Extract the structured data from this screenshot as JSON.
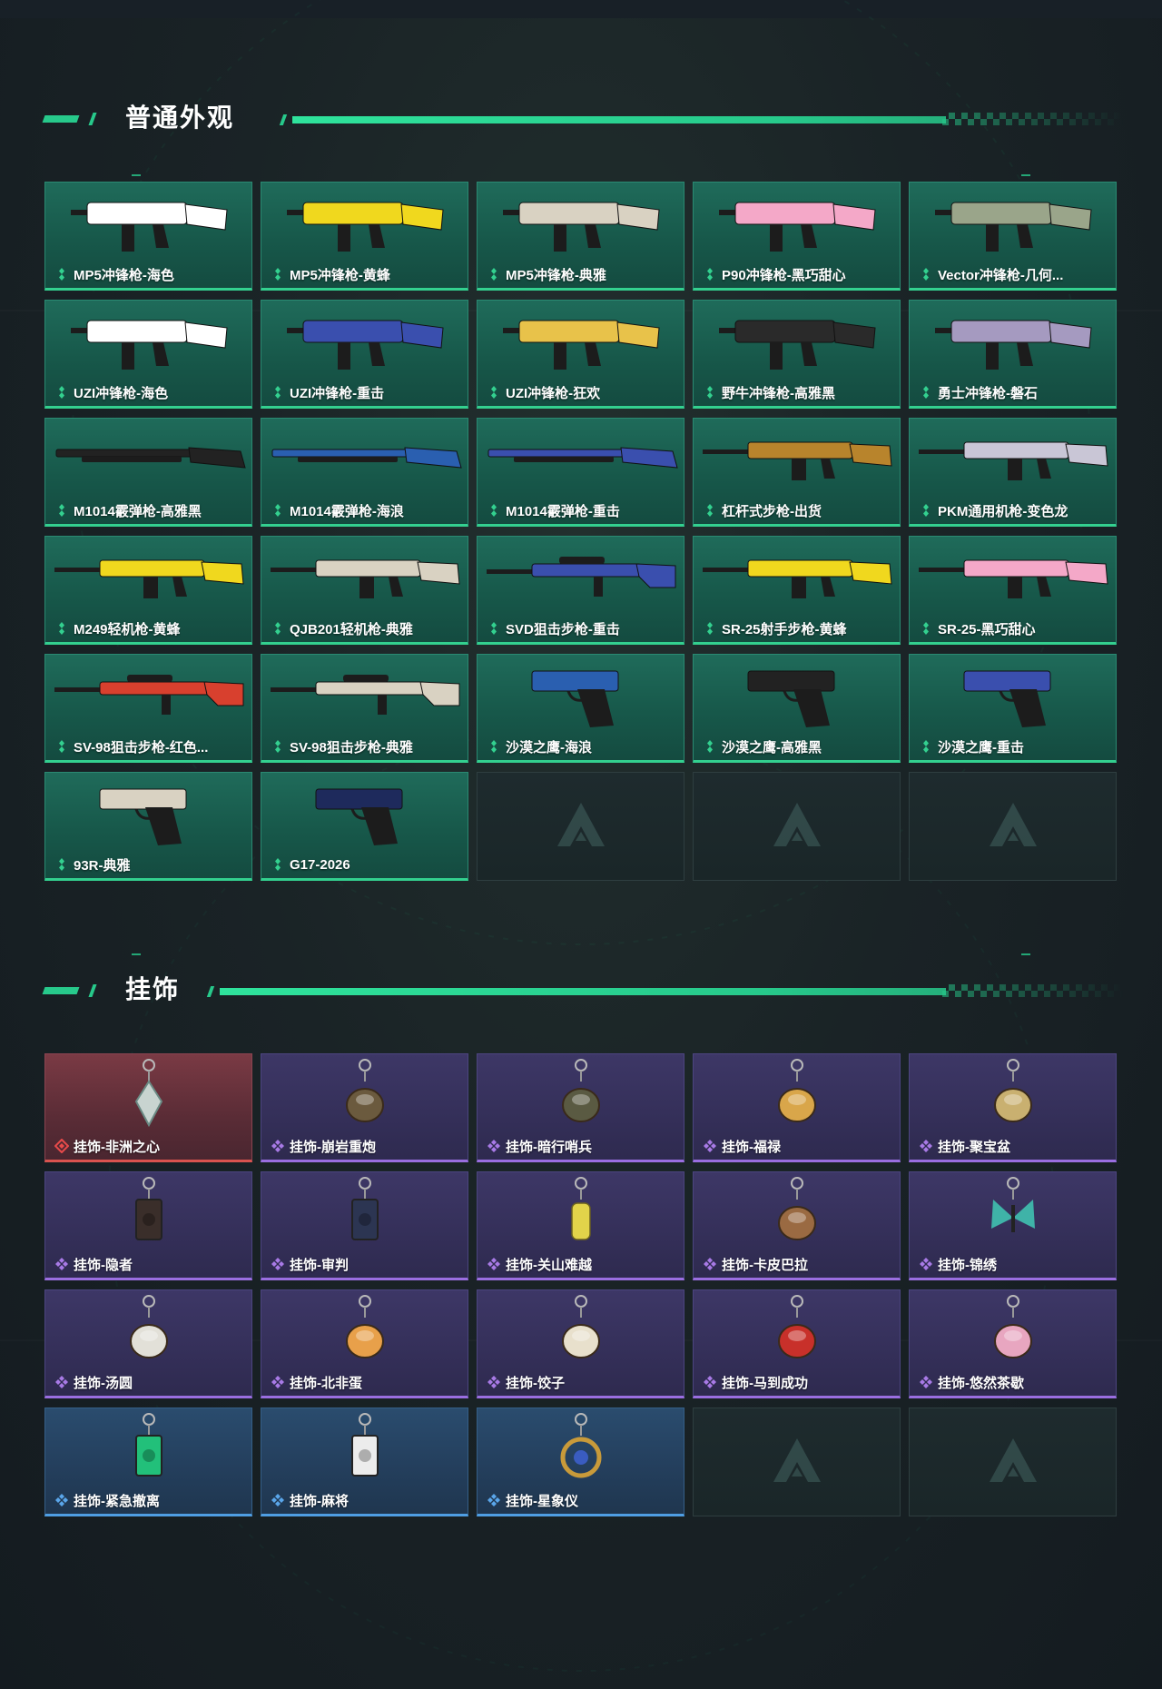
{
  "colors": {
    "accent_green": "#27c98b",
    "weapon_card": "#1b5f50",
    "deco_red": "#d9534f",
    "deco_purple": "#9a6ee0",
    "deco_blue": "#4f9ee3"
  },
  "sections": {
    "weapon_skins": {
      "title": "普通外观",
      "items": [
        {
          "name": "MP5冲锋枪-海色",
          "icon": "smg-icon",
          "color": "#ffffff"
        },
        {
          "name": "MP5冲锋枪-黄蜂",
          "icon": "smg-icon",
          "color": "#f0d81e"
        },
        {
          "name": "MP5冲锋枪-典雅",
          "icon": "smg-icon",
          "color": "#d9d2c2"
        },
        {
          "name": "P90冲锋枪-黑巧甜心",
          "icon": "smg-icon",
          "color": "#f4a8c8"
        },
        {
          "name": "Vector冲锋枪-几何...",
          "icon": "smg-icon",
          "color": "#9aa58a"
        },
        {
          "name": "UZI冲锋枪-海色",
          "icon": "smg-icon",
          "color": "#ffffff"
        },
        {
          "name": "UZI冲锋枪-重击",
          "icon": "smg-icon",
          "color": "#3a4fae"
        },
        {
          "name": "UZI冲锋枪-狂欢",
          "icon": "smg-icon",
          "color": "#e8c24a"
        },
        {
          "name": "野牛冲锋枪-高雅黑",
          "icon": "smg-icon",
          "color": "#2a2a2a"
        },
        {
          "name": "勇士冲锋枪-磐石",
          "icon": "smg-icon",
          "color": "#a59ac0"
        },
        {
          "name": "M1014霰弹枪-高雅黑",
          "icon": "shotgun-icon",
          "color": "#222222"
        },
        {
          "name": "M1014霰弹枪-海浪",
          "icon": "shotgun-icon",
          "color": "#2a5fb0"
        },
        {
          "name": "M1014霰弹枪-重击",
          "icon": "shotgun-icon",
          "color": "#3a4fae"
        },
        {
          "name": "杠杆式步枪-出货",
          "icon": "rifle-icon",
          "color": "#b8842c"
        },
        {
          "name": "PKM通用机枪-变色龙",
          "icon": "machine-gun-icon",
          "color": "#c9c6d6"
        },
        {
          "name": "M249轻机枪-黄蜂",
          "icon": "machine-gun-icon",
          "color": "#f0d81e"
        },
        {
          "name": "QJB201轻机枪-典雅",
          "icon": "machine-gun-icon",
          "color": "#d9d2c2"
        },
        {
          "name": "SVD狙击步枪-重击",
          "icon": "sniper-icon",
          "color": "#3a4fae"
        },
        {
          "name": "SR-25射手步枪-黄蜂",
          "icon": "rifle-icon",
          "color": "#f0d81e"
        },
        {
          "name": "SR-25-黑巧甜心",
          "icon": "rifle-icon",
          "color": "#f4a8c8"
        },
        {
          "name": "SV-98狙击步枪-红色...",
          "icon": "sniper-icon",
          "color": "#d8402e"
        },
        {
          "name": "SV-98狙击步枪-典雅",
          "icon": "sniper-icon",
          "color": "#d9d2c2"
        },
        {
          "name": "沙漠之鹰-海浪",
          "icon": "pistol-icon",
          "color": "#2a5fb0"
        },
        {
          "name": "沙漠之鹰-高雅黑",
          "icon": "pistol-icon",
          "color": "#222222"
        },
        {
          "name": "沙漠之鹰-重击",
          "icon": "pistol-icon",
          "color": "#3a4fae"
        },
        {
          "name": "93R-典雅",
          "icon": "pistol-icon",
          "color": "#d9d2c2"
        },
        {
          "name": "G17-2026",
          "icon": "pistol-icon",
          "color": "#1e2a5c"
        }
      ]
    },
    "pendants": {
      "title": "挂饰",
      "items": [
        {
          "name": "挂饰-非洲之心",
          "rarity": "red",
          "icon": "gem-pendant-icon",
          "color": "#c8d4d0"
        },
        {
          "name": "挂饰-崩岩重炮",
          "rarity": "purple",
          "icon": "figure-pendant-icon",
          "color": "#6b5a3e"
        },
        {
          "name": "挂饰-暗行哨兵",
          "rarity": "purple",
          "icon": "figure-pendant-icon",
          "color": "#5a5a42"
        },
        {
          "name": "挂饰-福禄",
          "rarity": "purple",
          "icon": "gourd-pendant-icon",
          "color": "#d9a64a"
        },
        {
          "name": "挂饰-聚宝盆",
          "rarity": "purple",
          "icon": "bowl-pendant-icon",
          "color": "#c9b070"
        },
        {
          "name": "挂饰-隐者",
          "rarity": "purple",
          "icon": "card-pendant-icon",
          "color": "#3a2e2a"
        },
        {
          "name": "挂饰-审判",
          "rarity": "purple",
          "icon": "card-pendant-icon",
          "color": "#2c3552"
        },
        {
          "name": "挂饰-关山难越",
          "rarity": "purple",
          "icon": "cylinder-pendant-icon",
          "color": "#e2d34a"
        },
        {
          "name": "挂饰-卡皮巴拉",
          "rarity": "purple",
          "icon": "capybara-pendant-icon",
          "color": "#9a6a42"
        },
        {
          "name": "挂饰-锦绣",
          "rarity": "purple",
          "icon": "butterfly-pendant-icon",
          "color": "#3fb3a8"
        },
        {
          "name": "挂饰-汤圆",
          "rarity": "purple",
          "icon": "bowl-pendant-icon",
          "color": "#e2e0d8"
        },
        {
          "name": "挂饰-北非蛋",
          "rarity": "purple",
          "icon": "bowl-pendant-icon",
          "color": "#e8a04a"
        },
        {
          "name": "挂饰-饺子",
          "rarity": "purple",
          "icon": "bowl-pendant-icon",
          "color": "#e8e0cc"
        },
        {
          "name": "挂饰-马到成功",
          "rarity": "purple",
          "icon": "horse-pendant-icon",
          "color": "#c8302a"
        },
        {
          "name": "挂饰-悠然茶歇",
          "rarity": "purple",
          "icon": "cake-pendant-icon",
          "color": "#e8a6c0"
        },
        {
          "name": "挂饰-紧急撤离",
          "rarity": "blue",
          "icon": "sign-pendant-icon",
          "color": "#22c07a"
        },
        {
          "name": "挂饰-麻将",
          "rarity": "blue",
          "icon": "mahjong-pendant-icon",
          "color": "#ececec"
        },
        {
          "name": "挂饰-星象仪",
          "rarity": "blue",
          "icon": "astrolabe-pendant-icon",
          "color": "#c89a3a"
        }
      ]
    }
  }
}
